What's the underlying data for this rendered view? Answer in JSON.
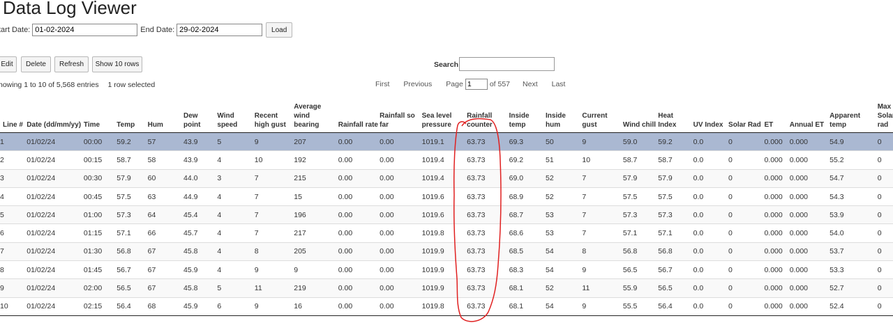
{
  "title": "Data Log Viewer",
  "filters": {
    "start_label": "tart Date:",
    "start_value": "01-02-2024",
    "end_label": "End Date:",
    "end_value": "29-02-2024",
    "load_label": "Load"
  },
  "toolbar": {
    "edit_label": "Edit",
    "delete_label": "Delete",
    "refresh_label": "Refresh",
    "show_rows_label": "Show 10 rows"
  },
  "search": {
    "label": "Search:",
    "value": ""
  },
  "info": {
    "showing": "howing 1 to 10 of 5,568 entries",
    "selected": "1 row selected"
  },
  "pager": {
    "first": "First",
    "previous": "Previous",
    "page_label": "Page",
    "page_value": "1",
    "of_label": "of 557",
    "next": "Next",
    "last": "Last"
  },
  "columns": [
    {
      "label": "Line #",
      "w": 38
    },
    {
      "label": "Date (dd/mm/yy)",
      "w": 81
    },
    {
      "label": "Time",
      "w": 47
    },
    {
      "label": "Temp",
      "w": 44
    },
    {
      "label": "Hum",
      "w": 51
    },
    {
      "label": "Dew point",
      "w": 48
    },
    {
      "label": "Wind speed",
      "w": 53
    },
    {
      "label": "Recent high gust",
      "w": 56
    },
    {
      "label": "Average wind bearing",
      "w": 63
    },
    {
      "label": "Rainfall rate",
      "w": 59
    },
    {
      "label": "Rainfall so far",
      "w": 60
    },
    {
      "label": "Sea level pressure",
      "w": 64
    },
    {
      "label": "Rainfall counter",
      "w": 60
    },
    {
      "label": "Inside temp",
      "w": 52
    },
    {
      "label": "Inside hum",
      "w": 52
    },
    {
      "label": "Current gust",
      "w": 58
    },
    {
      "label": "Wind chill",
      "w": 50
    },
    {
      "label": "Heat Index",
      "w": 50
    },
    {
      "label": "UV Index",
      "w": 50
    },
    {
      "label": "Solar Rad",
      "w": 51
    },
    {
      "label": "ET",
      "w": 36
    },
    {
      "label": "Annual ET",
      "w": 57
    },
    {
      "label": "Apparent temp",
      "w": 68
    },
    {
      "label": "Max Solar rad",
      "w": 32
    }
  ],
  "rows": [
    [
      "1",
      "01/02/24",
      "00:00",
      "59.2",
      "57",
      "43.9",
      "5",
      "9",
      "207",
      "0.00",
      "0.00",
      "1019.1",
      "63.73",
      "69.3",
      "50",
      "9",
      "59.0",
      "59.2",
      "0.0",
      "0",
      "0.000",
      "0.000",
      "54.9",
      "0"
    ],
    [
      "2",
      "01/02/24",
      "00:15",
      "58.7",
      "58",
      "43.9",
      "4",
      "10",
      "192",
      "0.00",
      "0.00",
      "1019.4",
      "63.73",
      "69.2",
      "51",
      "10",
      "58.7",
      "58.7",
      "0.0",
      "0",
      "0.000",
      "0.000",
      "55.2",
      "0"
    ],
    [
      "3",
      "01/02/24",
      "00:30",
      "57.9",
      "60",
      "44.0",
      "3",
      "7",
      "215",
      "0.00",
      "0.00",
      "1019.4",
      "63.73",
      "69.0",
      "52",
      "7",
      "57.9",
      "57.9",
      "0.0",
      "0",
      "0.000",
      "0.000",
      "54.7",
      "0"
    ],
    [
      "4",
      "01/02/24",
      "00:45",
      "57.5",
      "63",
      "44.9",
      "4",
      "7",
      "15",
      "0.00",
      "0.00",
      "1019.6",
      "63.73",
      "68.9",
      "52",
      "7",
      "57.5",
      "57.5",
      "0.0",
      "0",
      "0.000",
      "0.000",
      "54.3",
      "0"
    ],
    [
      "5",
      "01/02/24",
      "01:00",
      "57.3",
      "64",
      "45.4",
      "4",
      "7",
      "196",
      "0.00",
      "0.00",
      "1019.6",
      "63.73",
      "68.7",
      "53",
      "7",
      "57.3",
      "57.3",
      "0.0",
      "0",
      "0.000",
      "0.000",
      "53.9",
      "0"
    ],
    [
      "6",
      "01/02/24",
      "01:15",
      "57.1",
      "66",
      "45.7",
      "4",
      "7",
      "217",
      "0.00",
      "0.00",
      "1019.8",
      "63.73",
      "68.6",
      "53",
      "7",
      "57.1",
      "57.1",
      "0.0",
      "0",
      "0.000",
      "0.000",
      "54.0",
      "0"
    ],
    [
      "7",
      "01/02/24",
      "01:30",
      "56.8",
      "67",
      "45.8",
      "4",
      "8",
      "205",
      "0.00",
      "0.00",
      "1019.9",
      "63.73",
      "68.5",
      "54",
      "8",
      "56.8",
      "56.8",
      "0.0",
      "0",
      "0.000",
      "0.000",
      "53.7",
      "0"
    ],
    [
      "8",
      "01/02/24",
      "01:45",
      "56.7",
      "67",
      "45.9",
      "4",
      "9",
      "9",
      "0.00",
      "0.00",
      "1019.9",
      "63.73",
      "68.3",
      "54",
      "9",
      "56.5",
      "56.7",
      "0.0",
      "0",
      "0.000",
      "0.000",
      "53.3",
      "0"
    ],
    [
      "9",
      "01/02/24",
      "02:00",
      "56.5",
      "67",
      "45.8",
      "5",
      "11",
      "219",
      "0.00",
      "0.00",
      "1019.9",
      "63.73",
      "68.1",
      "52",
      "11",
      "55.9",
      "56.5",
      "0.0",
      "0",
      "0.000",
      "0.000",
      "52.7",
      "0"
    ],
    [
      "10",
      "01/02/24",
      "02:15",
      "56.4",
      "68",
      "45.9",
      "6",
      "9",
      "16",
      "0.00",
      "0.00",
      "1019.8",
      "63.73",
      "68.1",
      "54",
      "9",
      "55.5",
      "56.4",
      "0.0",
      "0",
      "0.000",
      "0.000",
      "52.4",
      "0"
    ]
  ],
  "selected_row": 0,
  "colors": {
    "selected_row": "#aab8d2",
    "annotation": "#e02020"
  }
}
